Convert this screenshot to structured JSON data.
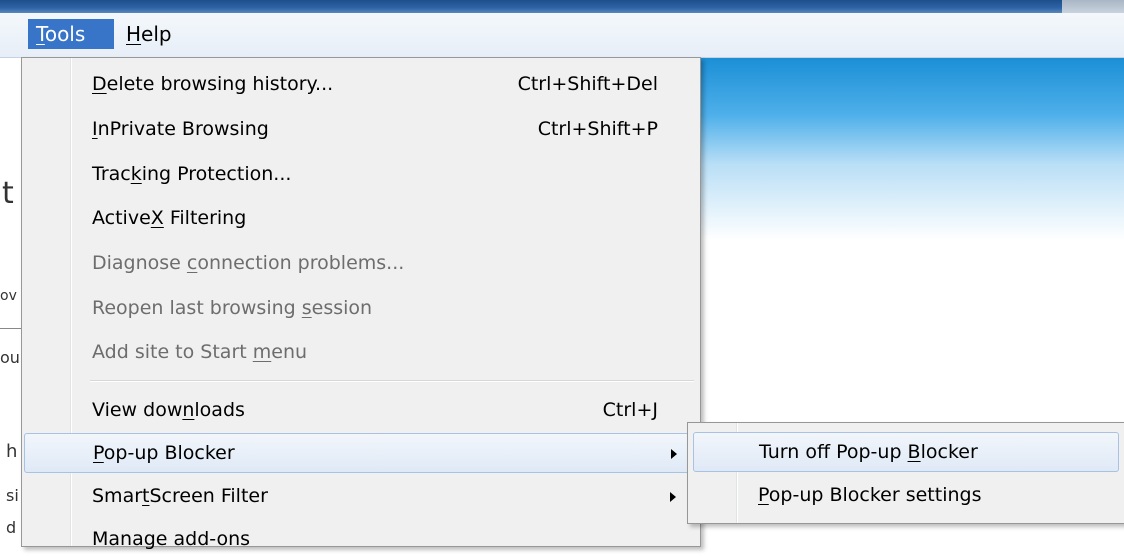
{
  "menubar": {
    "tools": {
      "pre": "",
      "key": "T",
      "post": "ools"
    },
    "help": {
      "pre": "",
      "key": "H",
      "post": "elp"
    }
  },
  "page_fragments": [
    "t",
    "ov",
    "ou",
    "h",
    "si",
    "d"
  ],
  "tools_menu": {
    "items": [
      {
        "pre": "",
        "key": "D",
        "post": "elete browsing history...",
        "shortcut": "Ctrl+Shift+Del"
      },
      {
        "pre": "",
        "key": "I",
        "post": "nPrivate Browsing",
        "shortcut": "Ctrl+Shift+P"
      },
      {
        "pre": "Trac",
        "key": "k",
        "post": "ing Protection...",
        "shortcut": ""
      },
      {
        "pre": "Active",
        "key": "X",
        "post": " Filtering",
        "shortcut": ""
      },
      {
        "pre": "Diagnose ",
        "key": "c",
        "post": "onnection problems...",
        "shortcut": ""
      },
      {
        "pre": "Reopen last browsing ",
        "key": "s",
        "post": "ession",
        "shortcut": ""
      },
      {
        "pre": "Add site to Start ",
        "key": "m",
        "post": "enu",
        "shortcut": ""
      },
      {
        "pre": "View dow",
        "key": "n",
        "post": "loads",
        "shortcut": "Ctrl+J"
      },
      {
        "pre": "",
        "key": "P",
        "post": "op-up Blocker",
        "shortcut": ""
      },
      {
        "pre": "Smar",
        "key": "t",
        "post": "Screen Filter",
        "shortcut": ""
      },
      {
        "pre": "Manage add-ons",
        "key": "",
        "post": "",
        "shortcut": ""
      }
    ]
  },
  "popup_submenu": {
    "items": [
      {
        "pre": "Turn off Pop-up ",
        "key": "B",
        "post": "locker"
      },
      {
        "pre": "",
        "key": "P",
        "post": "op-up Blocker settings"
      }
    ]
  }
}
